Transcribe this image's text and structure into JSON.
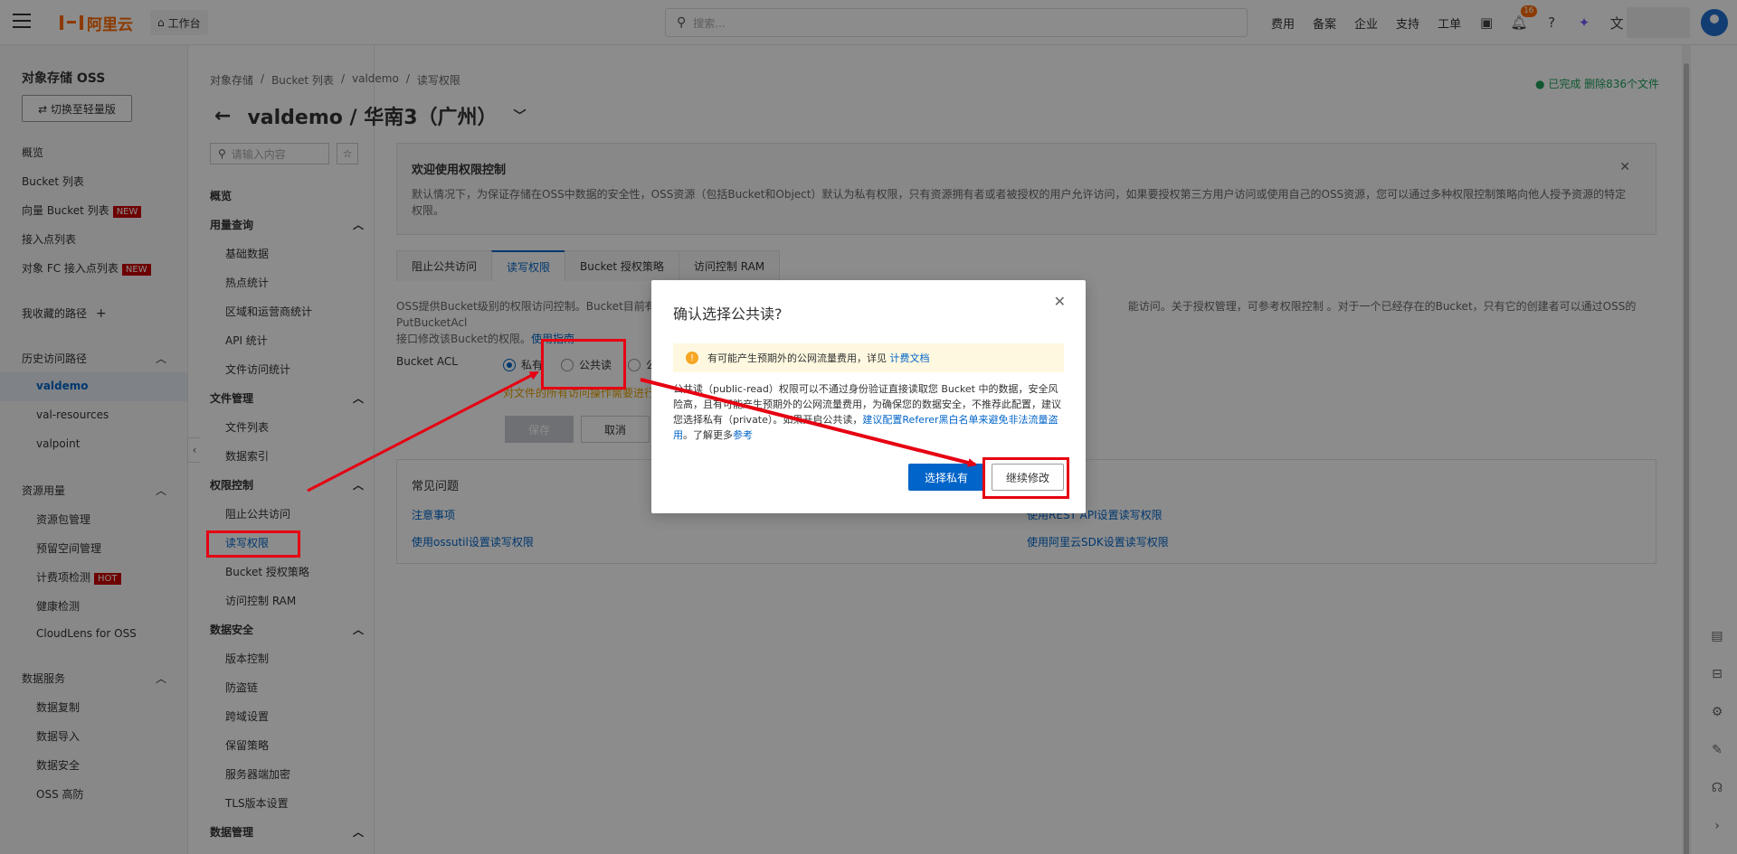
{
  "topbar": {
    "logo": "阿里云",
    "workbench": "工作台",
    "search_placeholder": "搜索...",
    "nav": [
      "费用",
      "备案",
      "企业",
      "支持",
      "工单"
    ],
    "notification_count": "16"
  },
  "leftnav": {
    "title": "对象存储 OSS",
    "switch_label": "⇄ 切换至轻量版",
    "items": [
      "概览",
      "Bucket 列表",
      "向量 Bucket 列表",
      "接入点列表",
      "对象 FC 接入点列表"
    ],
    "new_tag": "NEW",
    "hot_tag": "HOT",
    "favorites": "我收藏的路径",
    "history": "历史访问路径",
    "history_items": [
      "valdemo",
      "val-resources",
      "valpoint"
    ],
    "resource_usage": "资源用量",
    "resource_items": [
      "资源包管理",
      "预留空间管理",
      "计费项检测",
      "健康检测",
      "CloudLens for OSS"
    ],
    "data_service": "数据服务",
    "data_items": [
      "数据复制",
      "数据导入",
      "数据安全",
      "OSS 高防"
    ]
  },
  "secnav": {
    "search_placeholder": "请输入内容",
    "overview": "概览",
    "usage": "用量查询",
    "usage_items": [
      "基础数据",
      "热点统计",
      "区域和运营商统计",
      "API 统计",
      "文件访问统计"
    ],
    "files": "文件管理",
    "files_items": [
      "文件列表",
      "数据索引"
    ],
    "perm": "权限控制",
    "perm_items": [
      "阻止公共访问",
      "读写权限",
      "Bucket 授权策略",
      "访问控制 RAM"
    ],
    "datasec": "数据安全",
    "datasec_items": [
      "版本控制",
      "防盗链",
      "跨域设置",
      "保留策略",
      "服务器端加密",
      "TLS版本设置"
    ],
    "datamgmt": "数据管理"
  },
  "main": {
    "breadcrumb": [
      "对象存储",
      "Bucket 列表",
      "valdemo",
      "读写权限"
    ],
    "done_text": "已完成 删除836个文件",
    "title": "valdemo / 华南3（广州）",
    "welcome_title": "欢迎使用权限控制",
    "welcome_desc": "默认情况下，为保证存储在OSS中数据的安全性，OSS资源（包括Bucket和Object）默认为私有权限，只有资源拥有者或者被授权的用户允许访问，如果要授权第三方用户访问或使用自己的OSS资源，您可以通过多种权限控制策略向他人授予资源的特定权限。",
    "tabs": [
      "阻止公共访问",
      "读写权限",
      "Bucket 授权策略",
      "访问控制 RAM"
    ],
    "desc_line1": "OSS提供Bucket级别的权限访问控制。Bucket目前有三",
    "desc_line1_tail": "能访问。关于授权管理，可参考权限控制 。对于一个已经存在的Bucket，只有它的创建者可以通过OSS的PutBucketAcl",
    "desc_line2": "接口修改该Bucket的权限。",
    "desc_link": "使用指南",
    "acl_label": "Bucket ACL",
    "acl_options": [
      "私有",
      "公共读",
      "公"
    ],
    "warn_text": "对文件的所有访问操作需要进行",
    "save": "保存",
    "cancel": "取消",
    "faq_title": "常见问题",
    "faq_links": [
      "注意事项",
      "使用ossutil设置读写权限",
      "使用REST API设置读写权限",
      "使用阿里云SDK设置读写权限"
    ]
  },
  "dialog": {
    "title": "确认选择公共读?",
    "warn": "有可能产生预期外的公网流量费用，详见",
    "warn_link": "计费文档",
    "body1": "公共读（public-read）权限可以不通过身份验证直接读取您 Bucket 中的数据，安全风险高，且有可能产生预期外的公网流量费用，为确保您的数据安全，不推荐此配置，建议您选择私有（private）。如果开启公共读，",
    "body_link": "建议配置Referer黑白名单来避免非法流量盗用",
    "body2": "。了解更多",
    "body_link2": "参考",
    "ok": "选择私有",
    "continue": "继续修改"
  }
}
